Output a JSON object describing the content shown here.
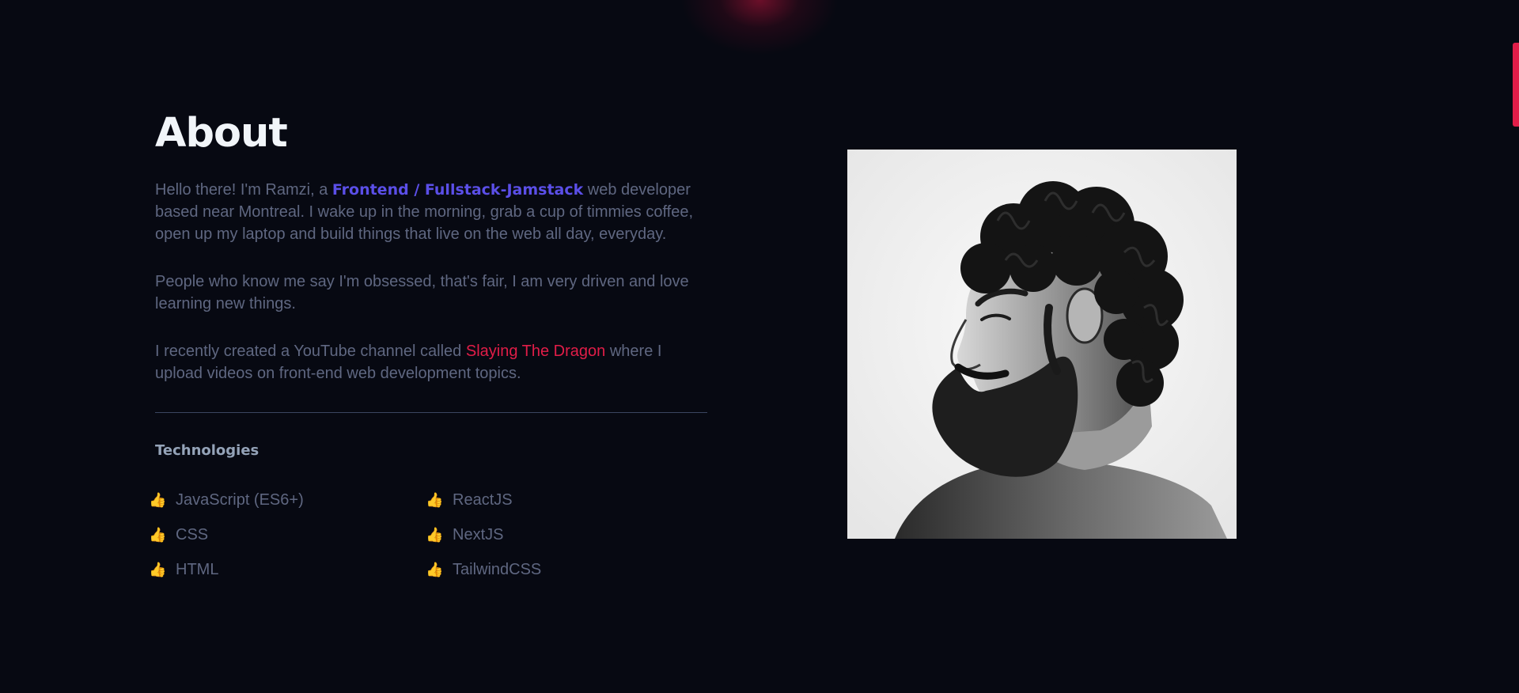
{
  "about": {
    "title": "About",
    "paragraph1": {
      "before": "Hello there! I'm Ramzi, a ",
      "highlight": "Frontend / Fullstack-Jamstack",
      "after": " web developer based near Montreal. I wake up in the morning, grab a cup of timmies coffee, open up my laptop and build things that live on the web all day, everyday."
    },
    "paragraph2": "People who know me say I'm obsessed, that's fair, I am very driven and love learning new things.",
    "paragraph3": {
      "before": "I recently created a YouTube channel called ",
      "link": "Slaying The Dragon",
      "after": " where I upload videos on front-end web development topics."
    }
  },
  "technologies": {
    "heading": "Technologies",
    "icon": "thumbs-up-icon",
    "items": [
      "JavaScript (ES6+)",
      "ReactJS",
      "CSS",
      "NextJS",
      "HTML",
      "TailwindCSS"
    ]
  },
  "colors": {
    "background": "#070912",
    "heading": "#f1f5f9",
    "body_text": "#5f6781",
    "highlight": "#5b4fe8",
    "accent": "#e11d48",
    "subheading": "#94a3b8",
    "thumb": "#f5b83d"
  },
  "portrait": {
    "description_icon": "portrait-photo"
  }
}
